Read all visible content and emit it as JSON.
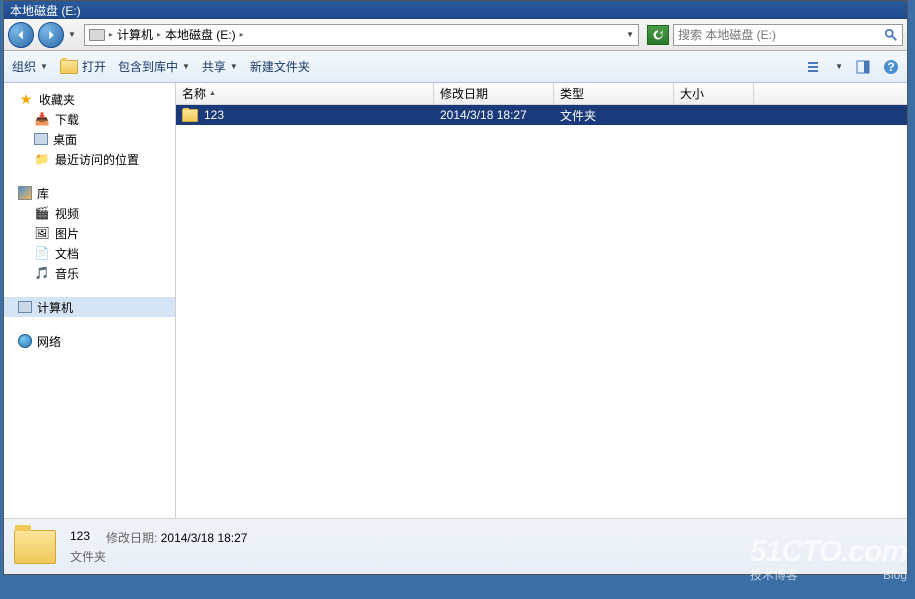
{
  "title": "本地磁盘 (E:)",
  "breadcrumb": {
    "root": "计算机",
    "current": "本地磁盘 (E:)"
  },
  "search": {
    "placeholder": "搜索 本地磁盘 (E:)"
  },
  "toolbar": {
    "organize": "组织",
    "open": "打开",
    "include": "包含到库中",
    "share": "共享",
    "newfolder": "新建文件夹"
  },
  "sidebar": {
    "favorites": {
      "label": "收藏夹",
      "items": [
        "下载",
        "桌面",
        "最近访问的位置"
      ]
    },
    "libraries": {
      "label": "库",
      "items": [
        "视频",
        "图片",
        "文档",
        "音乐"
      ]
    },
    "computer": "计算机",
    "network": "网络"
  },
  "columns": {
    "name": "名称",
    "date": "修改日期",
    "type": "类型",
    "size": "大小"
  },
  "files": [
    {
      "name": "123",
      "date": "2014/3/18 18:27",
      "type": "文件夹",
      "size": ""
    }
  ],
  "details": {
    "name": "123",
    "date_label": "修改日期:",
    "date": "2014/3/18 18:27",
    "type": "文件夹"
  },
  "watermark": {
    "main": "51CTO.com",
    "sub1": "技术博客",
    "sub2": "Blog"
  }
}
